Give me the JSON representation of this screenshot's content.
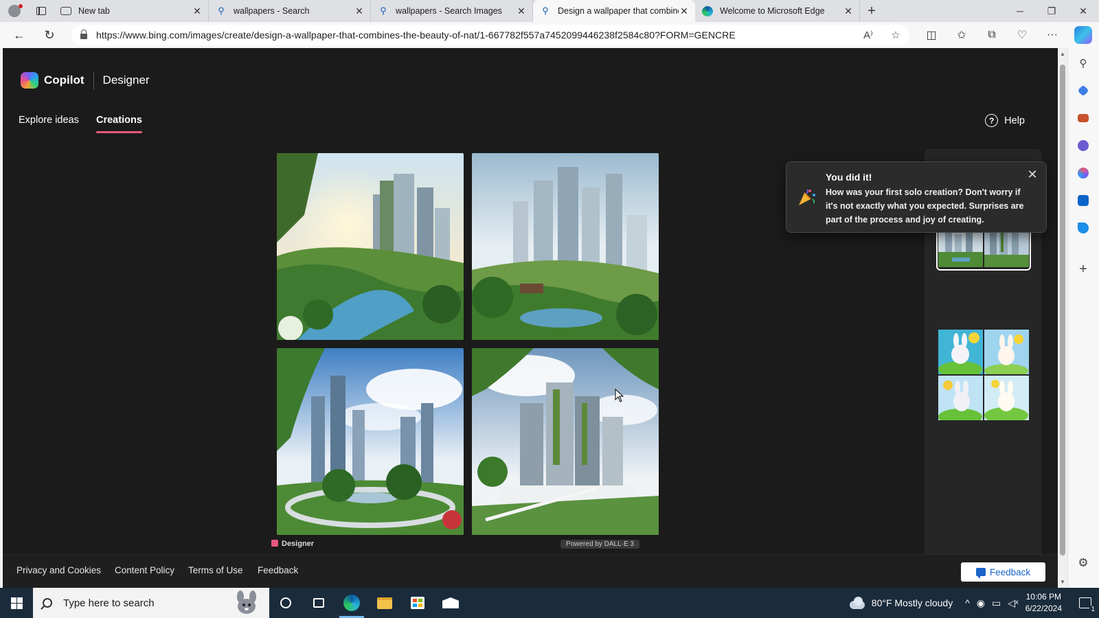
{
  "browser": {
    "tabs": [
      {
        "label": "New tab",
        "icon": "new-tab-icon"
      },
      {
        "label": "wallpapers - Search",
        "icon": "search-icon"
      },
      {
        "label": "wallpapers - Search Images",
        "icon": "search-icon"
      },
      {
        "label": "Design a wallpaper that combine",
        "icon": "search-icon",
        "active": true
      },
      {
        "label": "Welcome to Microsoft Edge",
        "icon": "edge-icon"
      }
    ],
    "url": "https://www.bing.com/images/create/design-a-wallpaper-that-combines-the-beauty-of-nat/1-667782f557a7452099446238f2584c80?FORM=GENCRE",
    "read_aloud_label": "A⁾"
  },
  "header": {
    "brand": "Copilot",
    "product": "Designer",
    "nav": [
      "Explore ideas",
      "Creations"
    ],
    "active_nav": "Creations",
    "help_label": "Help",
    "accent": "#e8587d"
  },
  "images": [
    {
      "description": "green-city-river-1"
    },
    {
      "description": "green-city-river-2"
    },
    {
      "description": "green-city-park-3"
    },
    {
      "description": "green-city-towers-4"
    }
  ],
  "below_grid": {
    "brand": "Designer",
    "powered": "Powered by DALL·E 3"
  },
  "toast": {
    "title": "You did it!",
    "body": "How was your first solo creation? Don't worry if it's not exactly what you expected. Surprises are part of the process and joy of creating.",
    "icon": "party-popper-icon"
  },
  "footer": {
    "links": [
      "Privacy and Cookies",
      "Content Policy",
      "Terms of Use",
      "Feedback"
    ],
    "feedback_button": "Feedback"
  },
  "taskbar": {
    "search_placeholder": "Type here to search",
    "weather": "80°F  Mostly cloudy",
    "time": "10:06 PM",
    "date": "6/22/2024",
    "notification_count": "1"
  }
}
